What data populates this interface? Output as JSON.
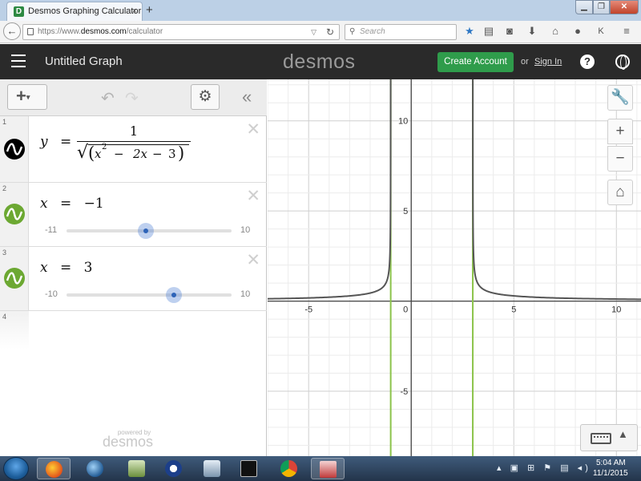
{
  "browser": {
    "tab_title": "Desmos Graphing Calculator",
    "tab_close": "×",
    "new_tab": "+",
    "url_prefix": "https://www.",
    "url_host": "desmos.com",
    "url_path": "/calculator",
    "search_placeholder": "Search",
    "toolbar_icons": [
      "star-icon",
      "reading-list-icon",
      "pocket-icon",
      "download-icon",
      "home-icon",
      "chat-icon",
      "addon-icon",
      "menu-icon"
    ]
  },
  "header": {
    "graph_title": "Untitled Graph",
    "logo": "desmos",
    "create_account": "Create Account",
    "or": "or",
    "sign_in": "Sign In",
    "help": "?"
  },
  "panel": {
    "add_label": "+",
    "expressions": [
      {
        "index": "1",
        "latex_text": "y = 1/√(x² − 2x − 3)",
        "lhs": "y",
        "eq": "=",
        "numerator": "1",
        "radicand_x": "x",
        "radicand_exp": "2",
        "radicand_minus1": "−",
        "radicand_2x": "2x",
        "radicand_minus2": "−",
        "radicand_3": "3",
        "color": "#000000"
      },
      {
        "index": "2",
        "lhs": "x",
        "eq": "=",
        "value": "−1",
        "slider_min": "-11",
        "slider_max": "10",
        "slider_fraction": 0.48,
        "color": "#6ca832"
      },
      {
        "index": "3",
        "lhs": "x",
        "eq": "=",
        "value": "3",
        "slider_min": "-10",
        "slider_max": "10",
        "slider_fraction": 0.65,
        "color": "#6ca832"
      },
      {
        "index": "4"
      }
    ],
    "powered_by": "powered by",
    "powered_logo": "desmos"
  },
  "graph": {
    "x_range": [
      -7,
      11.2
    ],
    "y_range": [
      -8.6,
      12.3
    ],
    "x_ticks": [
      "-5",
      "0",
      "5",
      "10"
    ],
    "y_ticks": [
      "10",
      "5",
      "-5"
    ],
    "curve_color": "#555555",
    "asymptote_color": "#8bc34a",
    "asymptotes": [
      -1,
      3
    ]
  },
  "taskbar": {
    "time": "5:04 AM",
    "date": "11/1/2015"
  }
}
